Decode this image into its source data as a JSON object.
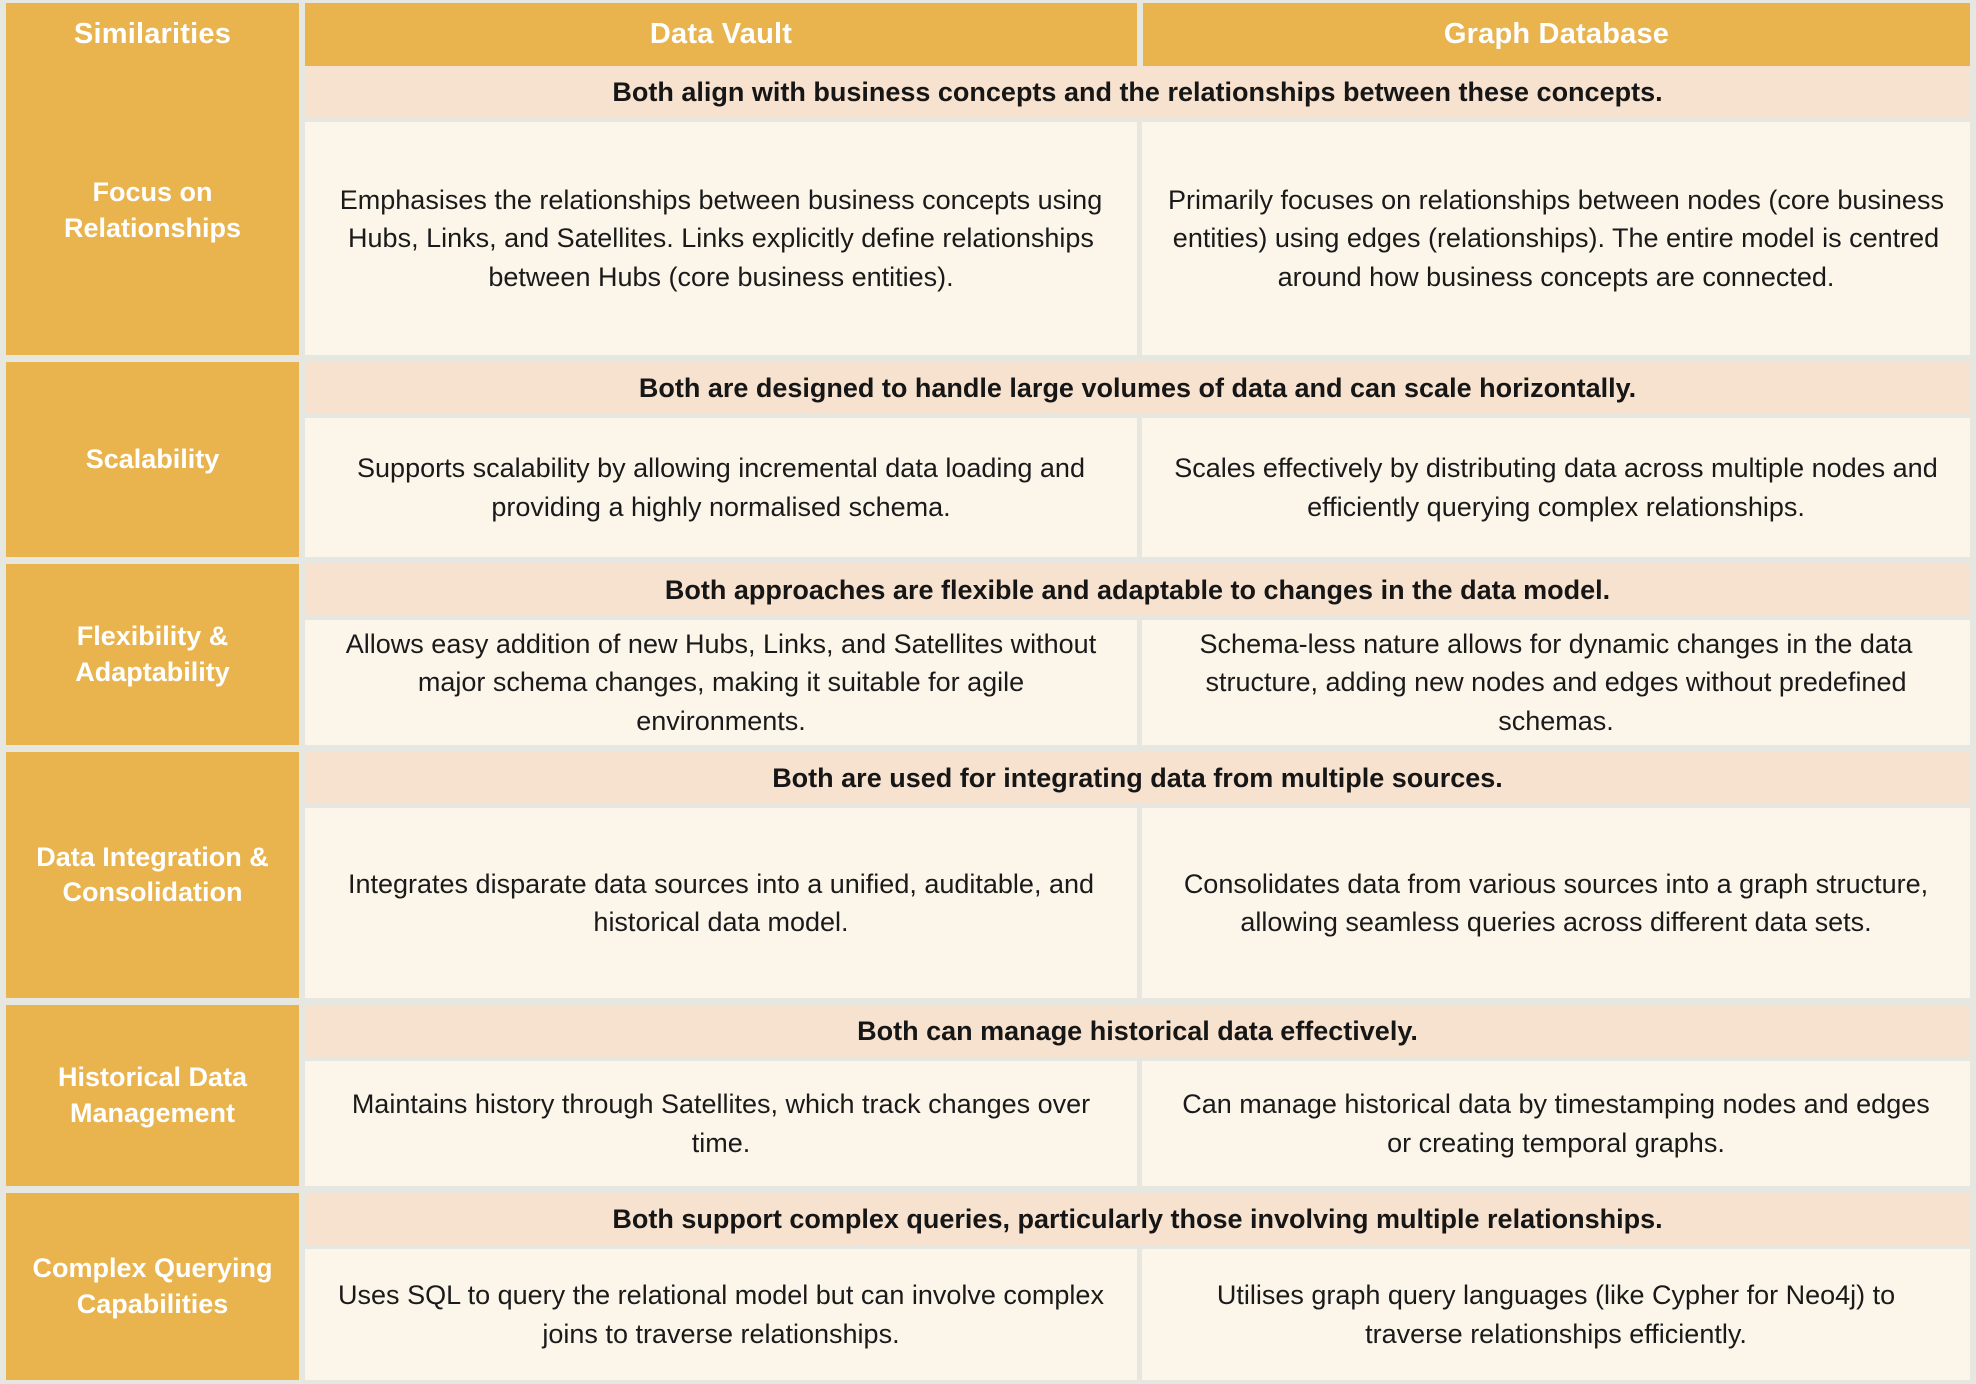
{
  "colors": {
    "accent": "#e9b34e",
    "banner_bg": "#f6e2ce",
    "cell_bg": "#fcf5ea",
    "page_bg": "#e6e7e1",
    "header_text": "#ffffff",
    "body_text": "#1a1a1a"
  },
  "header": {
    "label_column": "Similarities",
    "column_a": "Data Vault",
    "column_b": "Graph Database"
  },
  "rows": [
    {
      "label": "Focus on Relationships",
      "banner": "Both align with business concepts and the relationships between these concepts.",
      "data_vault": "Emphasises the relationships between business concepts using Hubs, Links, and Satellites. Links explicitly define relationships between Hubs (core business entities).",
      "graph_database": "Primarily focuses on relationships between nodes (core business entities) using edges (relationships). The entire model is centred around how business concepts are connected."
    },
    {
      "label": "Scalability",
      "banner": "Both are designed to handle large volumes of data and can scale horizontally.",
      "data_vault": "Supports scalability by allowing incremental data loading and providing a highly normalised schema.",
      "graph_database": "Scales effectively by distributing data across multiple nodes and efficiently querying complex relationships."
    },
    {
      "label": "Flexibility & Adaptability",
      "banner": "Both approaches are flexible and adaptable to changes in the data model.",
      "data_vault": "Allows easy addition of new Hubs, Links, and Satellites without major schema changes, making it suitable for agile environments.",
      "graph_database": "Schema-less nature allows for dynamic changes in the data structure, adding new nodes and edges without predefined schemas."
    },
    {
      "label": "Data Integration & Consolidation",
      "banner": "Both are used for integrating data from multiple sources.",
      "data_vault": "Integrates disparate data sources into a unified, auditable, and historical data model.",
      "graph_database": "Consolidates data from various sources into a graph structure, allowing seamless queries across different data sets."
    },
    {
      "label": "Historical Data Management",
      "banner": "Both can manage historical data effectively.",
      "data_vault": "Maintains history through Satellites, which track changes over time.",
      "graph_database": "Can manage historical data by timestamping nodes and edges or creating temporal graphs."
    },
    {
      "label": "Complex Querying Capabilities",
      "banner": "Both support complex queries, particularly those involving multiple relationships.",
      "data_vault": "Uses SQL to query the relational model but can involve complex joins to traverse relationships.",
      "graph_database": "Utilises graph query languages (like Cypher for Neo4j) to traverse relationships efficiently."
    }
  ]
}
